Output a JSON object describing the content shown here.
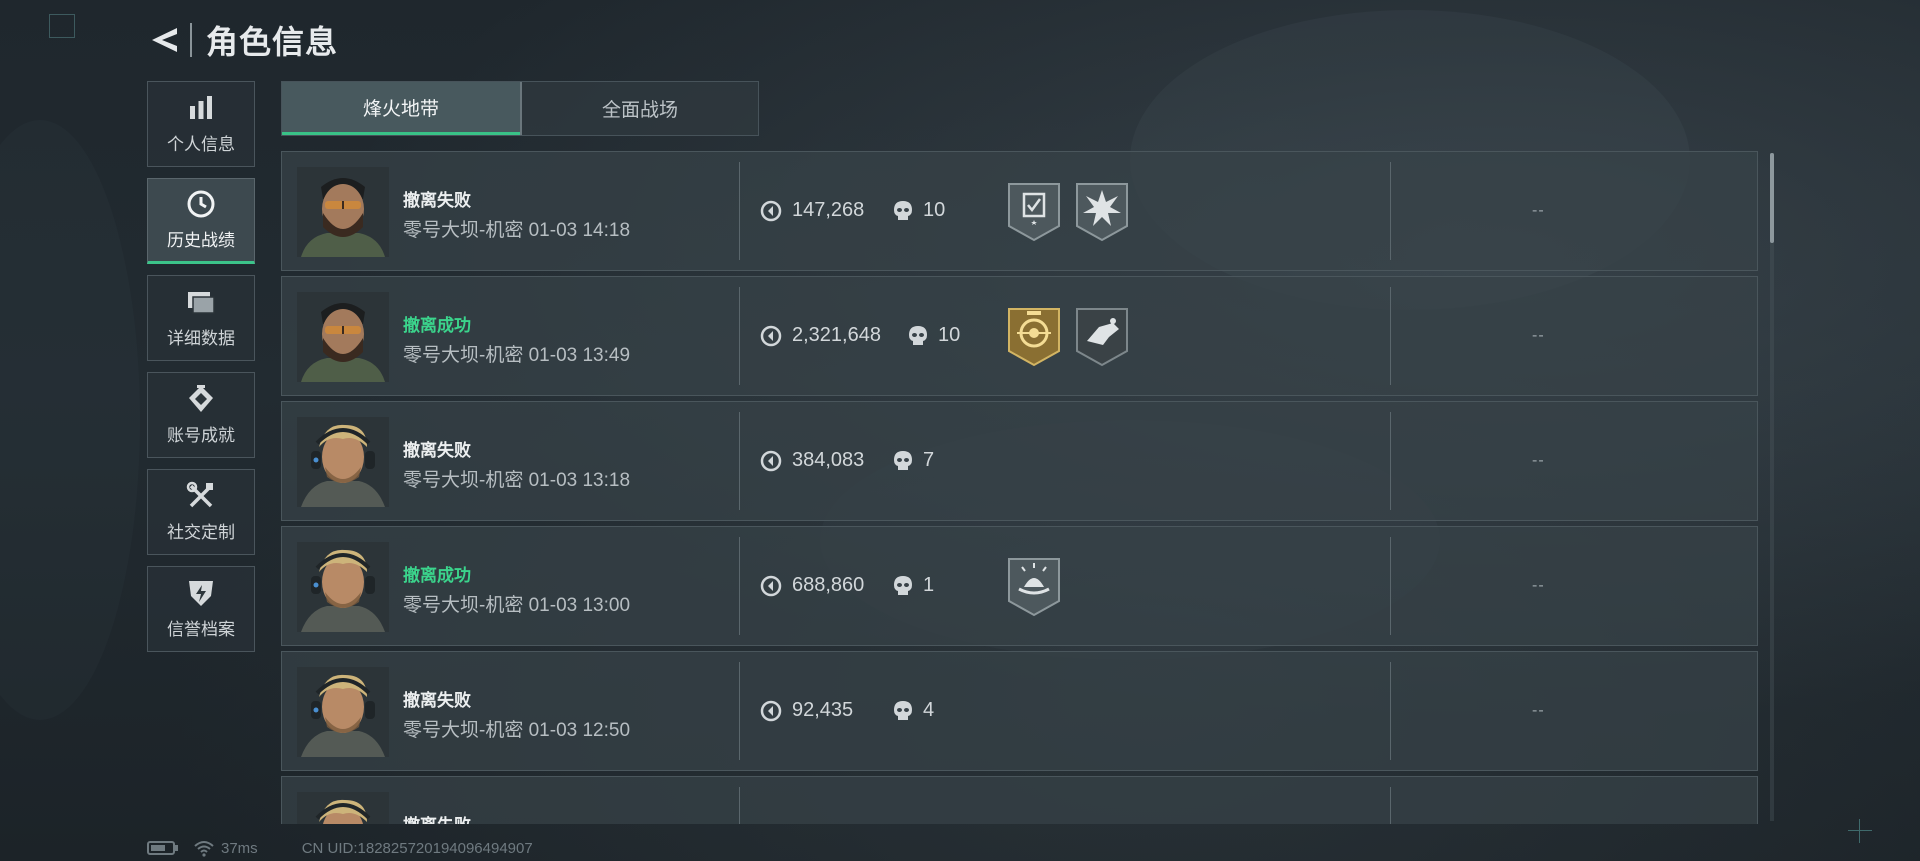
{
  "header": {
    "title": "角色信息",
    "back_icon": "back-arrow-icon"
  },
  "sidebar": {
    "items": [
      {
        "label": "个人信息",
        "icon": "bar-chart-icon",
        "active": false
      },
      {
        "label": "历史战绩",
        "icon": "clock-icon",
        "active": true
      },
      {
        "label": "详细数据",
        "icon": "cards-icon",
        "active": false
      },
      {
        "label": "账号成就",
        "icon": "medal-icon",
        "active": false
      },
      {
        "label": "社交定制",
        "icon": "tools-icon",
        "active": false
      },
      {
        "label": "信誉档案",
        "icon": "shield-icon",
        "active": false
      }
    ]
  },
  "tabs": [
    {
      "label": "烽火地带",
      "active": true
    },
    {
      "label": "全面战场",
      "active": false
    }
  ],
  "records": [
    {
      "avatar": "operator-bearded-icon",
      "status": "撤离失败",
      "success": false,
      "map": "零号大坝-机密",
      "time": "01-03 14:18",
      "value": "147,268",
      "kills": "10",
      "badges": [
        "grey-checklist-badge-icon",
        "grey-starburst-badge-icon"
      ],
      "extra": "--"
    },
    {
      "avatar": "operator-bearded-icon",
      "status": "撤离成功",
      "success": true,
      "map": "零号大坝-机密",
      "time": "01-03 13:49",
      "value": "2,321,648",
      "kills": "10",
      "badges": [
        "gold-emblem-badge-icon",
        "dark-hand-badge-icon"
      ],
      "extra": "--"
    },
    {
      "avatar": "operator-blond-headset-icon",
      "status": "撤离失败",
      "success": false,
      "map": "零号大坝-机密",
      "time": "01-03 13:18",
      "value": "384,083",
      "kills": "7",
      "badges": [],
      "extra": "--"
    },
    {
      "avatar": "operator-blond-headset-icon",
      "status": "撤离成功",
      "success": true,
      "map": "零号大坝-机密",
      "time": "01-03 13:00",
      "value": "688,860",
      "kills": "1",
      "badges": [
        "grey-sunrise-badge-icon"
      ],
      "extra": "--"
    },
    {
      "avatar": "operator-blond-headset-icon",
      "status": "撤离失败",
      "success": false,
      "map": "零号大坝-机密",
      "time": "01-03 12:50",
      "value": "92,435",
      "kills": "4",
      "badges": [],
      "extra": "--"
    },
    {
      "avatar": "operator-blond-headset-icon",
      "status": "撤离失败",
      "success": false,
      "map": "",
      "time": "",
      "value": "",
      "kills": "",
      "badges": [],
      "extra": ""
    }
  ],
  "footer": {
    "ping": "37ms",
    "uid": "CN UID:18282572019409649​4907"
  },
  "colors": {
    "accent": "#3cc48a",
    "success": "#3bd48c",
    "text": "#d9dde0",
    "panel": "#384248"
  }
}
